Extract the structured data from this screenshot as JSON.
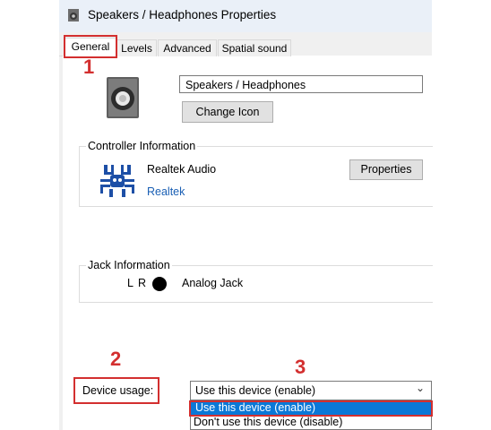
{
  "window": {
    "title": "Speakers / Headphones Properties"
  },
  "tabs": [
    {
      "label": "General"
    },
    {
      "label": "Levels"
    },
    {
      "label": "Advanced"
    },
    {
      "label": "Spatial sound"
    }
  ],
  "device": {
    "name": "Speakers / Headphones",
    "change_icon_label": "Change Icon"
  },
  "controller": {
    "group_label": "Controller Information",
    "name": "Realtek Audio",
    "vendor": "Realtek",
    "properties_label": "Properties"
  },
  "jack": {
    "group_label": "Jack Information",
    "channels": "L R",
    "type": "Analog Jack"
  },
  "usage": {
    "label": "Device usage:",
    "selected": "Use this device (enable)",
    "options": [
      "Use this device (enable)",
      "Don't use this device (disable)"
    ]
  },
  "annotations": {
    "step1": "1",
    "step2": "2",
    "step3": "3"
  },
  "colors": {
    "annotation": "#d32f2f",
    "highlight": "#0a78d7",
    "link": "#1a5fb4"
  }
}
